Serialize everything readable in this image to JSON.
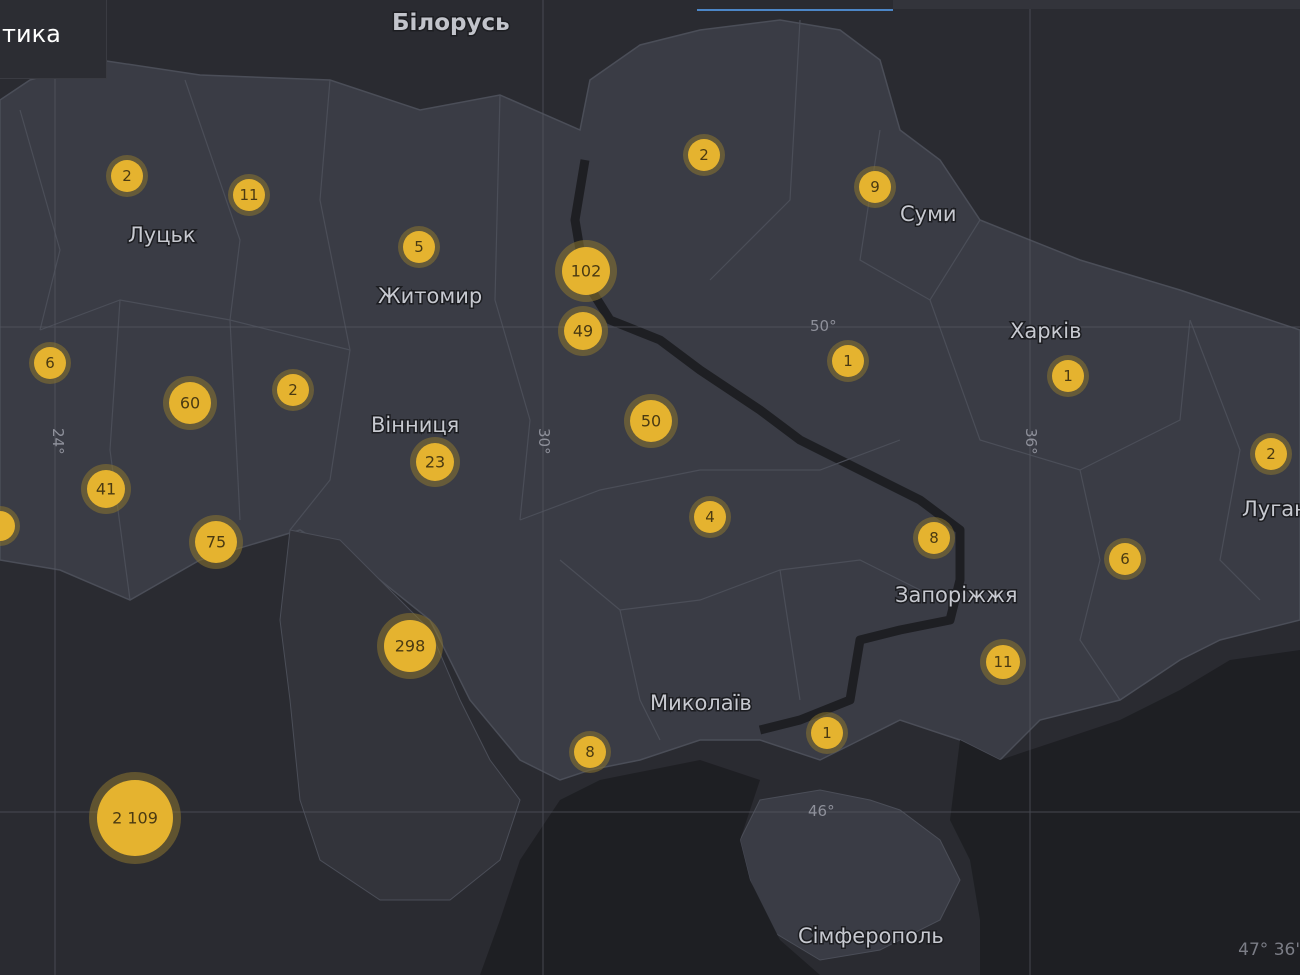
{
  "panel": {
    "title": "тика"
  },
  "coordinate_readout": "47° 36'",
  "colors": {
    "background": "#2a2b31",
    "ukraine_fill": "#3a3c45",
    "region_border": "#4b4e58",
    "water": "#1e1f23",
    "cluster_fill": "#e5b32f",
    "cluster_halo": "#8a7530",
    "tab_indicator": "#4c86c7"
  },
  "labels": {
    "country": {
      "belarus": "Білорусь"
    },
    "cities": {
      "lutsk": "Луцьк",
      "zhytomyr": "Житомир",
      "vinnytsia": "Вінниця",
      "sumy": "Суми",
      "kharkiv": "Харків",
      "zaporizhzhia": "Запоріжжя",
      "mykolaiv": "Миколаїв",
      "simferopol": "Сімферополь",
      "luhansk": "Луган"
    },
    "grid": {
      "lon24": "24°",
      "lon30": "30°",
      "lon36": "36°",
      "lat50": "50°",
      "lat46": "46°"
    }
  },
  "clusters": [
    {
      "id": "c1",
      "count": "2"
    },
    {
      "id": "c2",
      "count": "11"
    },
    {
      "id": "c3",
      "count": "5"
    },
    {
      "id": "c4",
      "count": "102"
    },
    {
      "id": "c5",
      "count": "2"
    },
    {
      "id": "c6",
      "count": "9"
    },
    {
      "id": "c7",
      "count": "49"
    },
    {
      "id": "c8",
      "count": "6"
    },
    {
      "id": "c9",
      "count": "60"
    },
    {
      "id": "c10",
      "count": "2"
    },
    {
      "id": "c11",
      "count": "50"
    },
    {
      "id": "c12",
      "count": "1"
    },
    {
      "id": "c13",
      "count": "1"
    },
    {
      "id": "c14",
      "count": "2"
    },
    {
      "id": "c15",
      "count": "41"
    },
    {
      "id": "c16",
      "count": "23"
    },
    {
      "id": "c17",
      "count": "4"
    },
    {
      "id": "c18",
      "count": "75"
    },
    {
      "id": "c19",
      "count": "8"
    },
    {
      "id": "c20",
      "count": "6"
    },
    {
      "id": "c21",
      "count": "298"
    },
    {
      "id": "c22",
      "count": "11"
    },
    {
      "id": "c23",
      "count": "8"
    },
    {
      "id": "c24",
      "count": "1"
    },
    {
      "id": "c25",
      "count": "2 109"
    }
  ]
}
